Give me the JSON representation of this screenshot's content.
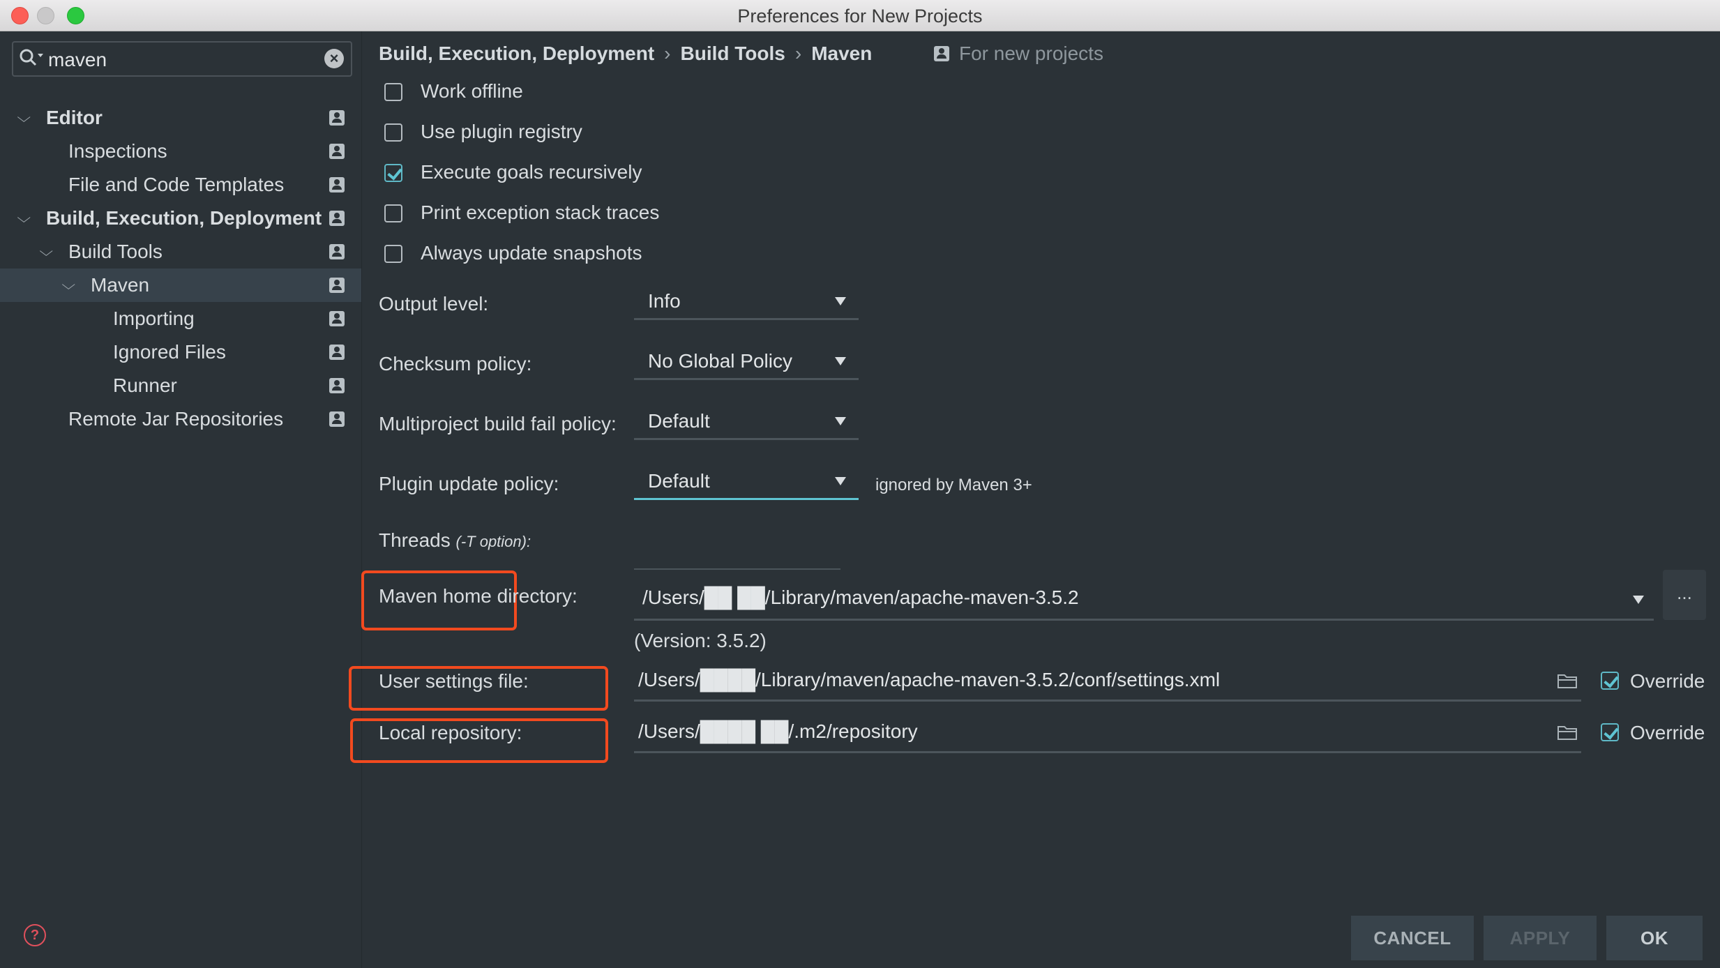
{
  "window": {
    "title": "Preferences for New Projects"
  },
  "search": {
    "value": "maven"
  },
  "sidebar": {
    "items": [
      {
        "label": "Editor"
      },
      {
        "label": "Inspections"
      },
      {
        "label": "File and Code Templates"
      },
      {
        "label": "Build, Execution, Deployment"
      },
      {
        "label": "Build Tools"
      },
      {
        "label": "Maven"
      },
      {
        "label": "Importing"
      },
      {
        "label": "Ignored Files"
      },
      {
        "label": "Runner"
      },
      {
        "label": "Remote Jar Repositories"
      }
    ],
    "help_icon": "?"
  },
  "breadcrumb": {
    "items": [
      "Build, Execution, Deployment",
      "Build Tools",
      "Maven"
    ],
    "separator": "›",
    "scope_label": "For new projects"
  },
  "checkboxes": [
    {
      "label": "Work offline",
      "checked": false
    },
    {
      "label": "Use plugin registry",
      "checked": false
    },
    {
      "label": "Execute goals recursively",
      "checked": true
    },
    {
      "label": "Print exception stack traces",
      "checked": false
    },
    {
      "label": "Always update snapshots",
      "checked": false
    }
  ],
  "fields": {
    "output_level": {
      "label": "Output level:",
      "value": "Info"
    },
    "checksum_policy": {
      "label": "Checksum policy:",
      "value": "No Global Policy"
    },
    "multiproject_fail": {
      "label": "Multiproject build fail policy:",
      "value": "Default"
    },
    "plugin_update": {
      "label": "Plugin update policy:",
      "value": "Default",
      "note": "ignored by Maven 3+"
    },
    "threads": {
      "label": "Threads",
      "hint": "(-T option):",
      "value": ""
    },
    "maven_home": {
      "label": "Maven home directory:",
      "value": "/Users/██ ██/Library/maven/apache-maven-3.5.2",
      "browse": "...",
      "version": "(Version: 3.5.2)"
    },
    "user_settings": {
      "label": "User settings file:",
      "value": "/Users/████/Library/maven/apache-maven-3.5.2/conf/settings.xml",
      "override_label": "Override",
      "override": true
    },
    "local_repo": {
      "label": "Local repository:",
      "value": "/Users/████ ██/.m2/repository",
      "override_label": "Override",
      "override": true
    }
  },
  "buttons": {
    "cancel": "CANCEL",
    "apply": "APPLY",
    "ok": "OK"
  },
  "colors": {
    "background": "#2b3237",
    "accent": "#5fc4d2",
    "highlight": "#f24a1f",
    "selected_row": "#37424b"
  }
}
